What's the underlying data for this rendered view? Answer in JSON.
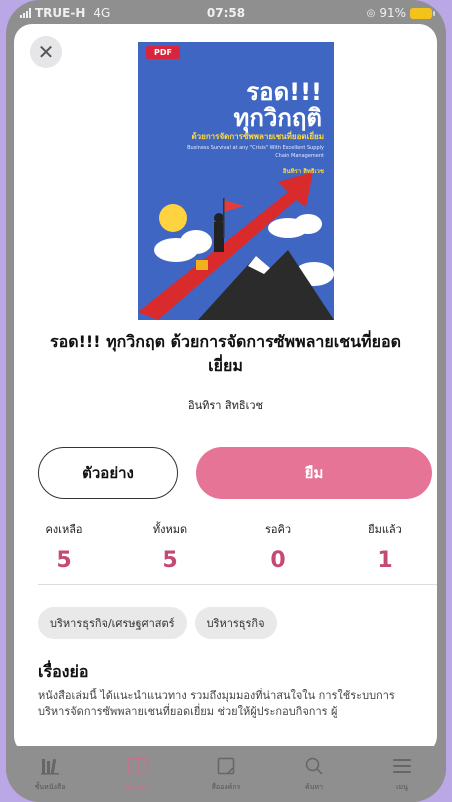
{
  "status_bar": {
    "carrier": "TRUE-H",
    "network": "4G",
    "time": "07:58",
    "battery": "91%"
  },
  "book": {
    "cover": {
      "badge": "PDF",
      "title_line1": "รอด!!!",
      "title_line2": "ทุกวิกฤติ",
      "subtitle": "ด้วยการจัดการซัพพลายเชนที่ยอดเยี่ยม",
      "english": "Business Survival at any \"Crisis\" With Excellent Supply Chain Management",
      "author": "อินทิรา สิทธิเวช"
    },
    "title": "รอด!!! ทุกวิกฤต ด้วยการจัดการซัพพลายเชนที่ยอดเยี่ยม",
    "author": "อินทิรา สิทธิเวช"
  },
  "actions": {
    "sample_label": "ตัวอย่าง",
    "borrow_label": "ยืม"
  },
  "stats": [
    {
      "label": "คงเหลือ",
      "value": "5"
    },
    {
      "label": "ทั้งหมด",
      "value": "5"
    },
    {
      "label": "รอคิว",
      "value": "0"
    },
    {
      "label": "ยืมแล้ว",
      "value": "1"
    }
  ],
  "tags": [
    "บริหารธุรกิจ/เศรษฐศาสตร์",
    "บริหารธุรกิจ"
  ],
  "synopsis": {
    "heading": "เรื่องย่อ",
    "text": "หนังสือเล่มนี้ ได้แนะนำแนวทาง รวมถึงมุมมองที่น่าสนใจใน การใช้ระบบการบริหารจัดการซัพพลายเชนที่ยอดเยี่ยม ช่วยให้ผู้ประกอบกิจการ ผู้"
  },
  "tabbar": [
    {
      "label": "ชั้นหนังสือ",
      "icon": "bookshelf-icon",
      "active": false
    },
    {
      "label": "ห้องสมุด",
      "icon": "library-icon",
      "active": true
    },
    {
      "label": "สื่อองค์กร",
      "icon": "media-icon",
      "active": false
    },
    {
      "label": "ค้นหา",
      "icon": "search-icon",
      "active": false
    },
    {
      "label": "เมนู",
      "icon": "menu-icon",
      "active": false
    }
  ],
  "colors": {
    "accent": "#e67496",
    "stat_value": "#c54a73",
    "cover_bg": "#3f66c3"
  }
}
